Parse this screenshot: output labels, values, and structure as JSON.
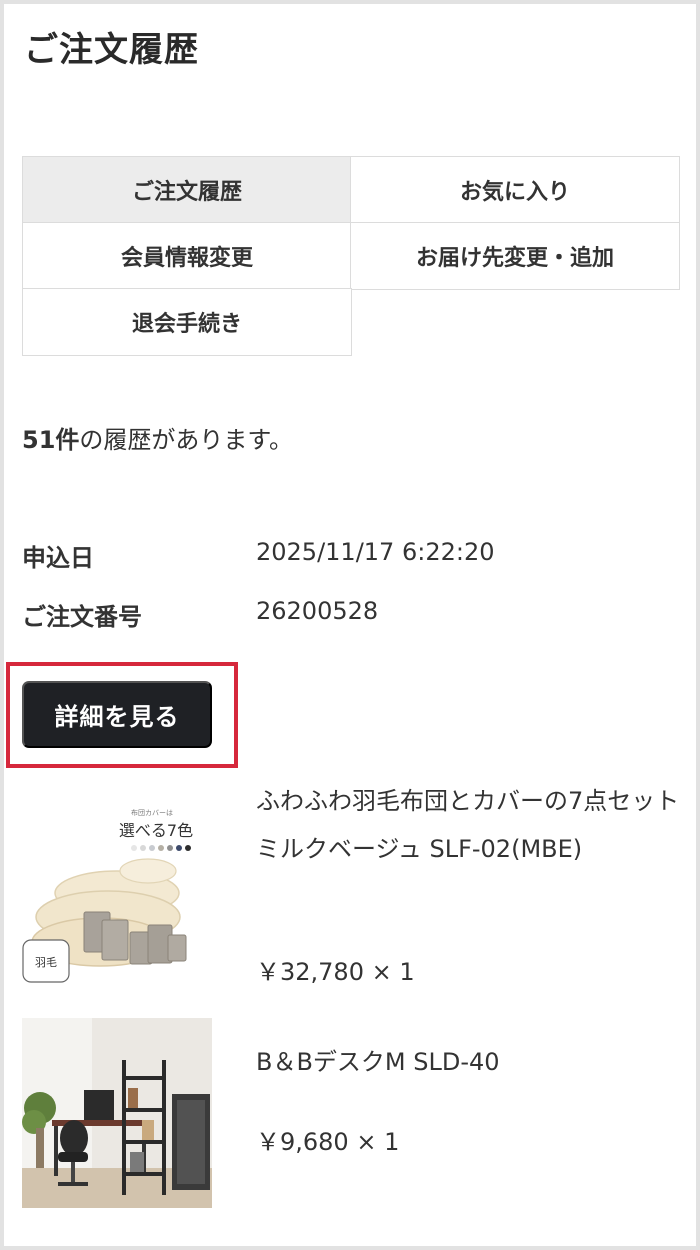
{
  "page": {
    "title": "ご注文履歴"
  },
  "menu": [
    {
      "label": "ご注文履歴",
      "active": true
    },
    {
      "label": "お気に入り",
      "active": false
    },
    {
      "label": "会員情報変更",
      "active": false
    },
    {
      "label": "お届け先変更・追加",
      "active": false
    },
    {
      "label": "退会手続き",
      "active": false
    }
  ],
  "summary": {
    "count": "51件",
    "text": "の履歴があります。"
  },
  "order": {
    "date_label": "申込日",
    "date_value": "2025/11/17 6:22:20",
    "number_label": "ご注文番号",
    "number_value": "26200528",
    "detail_button": "詳細を見る"
  },
  "products": [
    {
      "name": "ふわふわ羽毛布団とカバーの7点セット ミルクベージュ SLF-02(MBE)",
      "price": "￥32,780 × 1",
      "image_caption_small": "布団カバーは",
      "image_caption": "選べる7色",
      "image_badge": "羽毛"
    },
    {
      "name": "B＆BデスクM SLD-40",
      "price": "￥9,680 × 1"
    }
  ],
  "colors": {
    "button_bg": "#1f2125",
    "highlight": "#d6283c",
    "active_tab": "#ececec"
  }
}
